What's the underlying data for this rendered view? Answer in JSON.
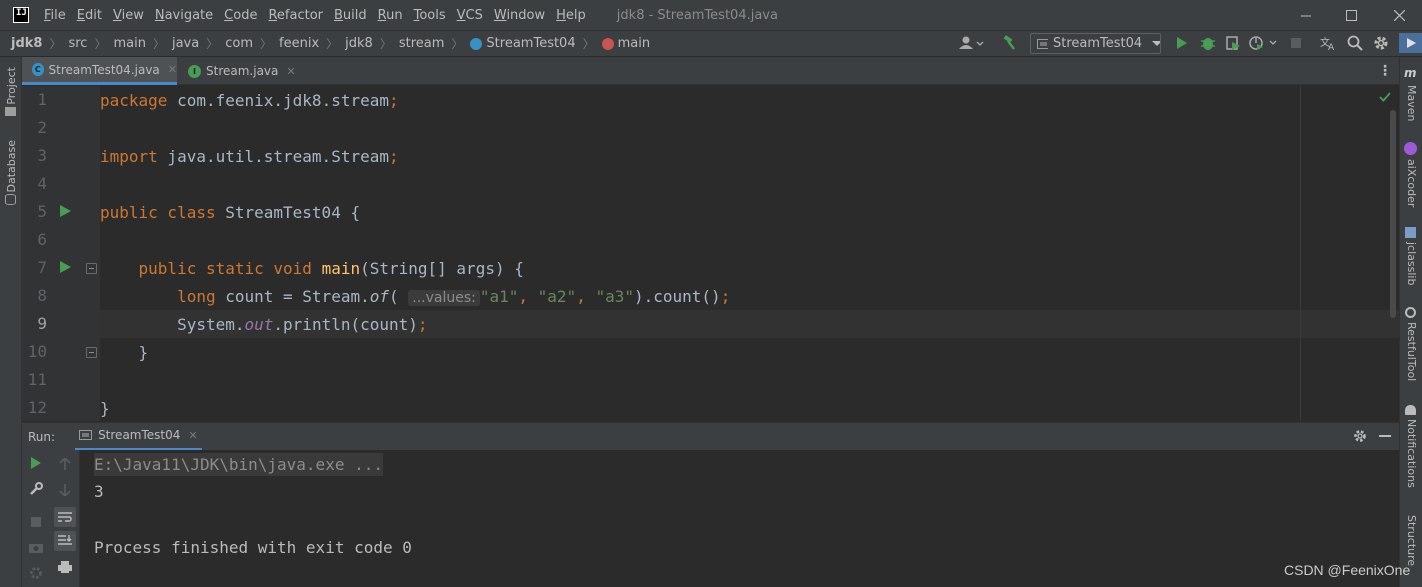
{
  "window": {
    "title": "jdk8 - StreamTest04.java",
    "logo": "IJ"
  },
  "menu": [
    "File",
    "Edit",
    "View",
    "Navigate",
    "Code",
    "Refactor",
    "Build",
    "Run",
    "Tools",
    "VCS",
    "Window",
    "Help"
  ],
  "breadcrumb": {
    "items": [
      "jdk8",
      "src",
      "main",
      "java",
      "com",
      "feenix",
      "jdk8",
      "stream",
      "StreamTest04",
      "main"
    ]
  },
  "toolbar": {
    "run_config": "StreamTest04"
  },
  "tabs": [
    {
      "label": "StreamTest04.java",
      "icon": "C"
    },
    {
      "label": "Stream.java",
      "icon": "I"
    }
  ],
  "editor": {
    "line_numbers": [
      "1",
      "2",
      "3",
      "4",
      "5",
      "6",
      "7",
      "8",
      "9",
      "10",
      "11",
      "12"
    ],
    "current_line": "9",
    "code": {
      "l1_kw": "package",
      "l1_rest": " com.feenix.jdk8.stream",
      "l1_semi": ";",
      "l3_kw": "import",
      "l3_rest": " java.util.stream.Stream",
      "l3_semi": ";",
      "l5_kw": "public class",
      "l5_rest": " StreamTest04 {",
      "l7_indent": "    ",
      "l7_kw": "public static void",
      "l7_space": " ",
      "l7_fn": "main",
      "l7_rest": "(String[] args) {",
      "l8_indent": "        ",
      "l8_kw": "long",
      "l8_a": " count = Stream.",
      "l8_of": "of",
      "l8_paren": "( ",
      "l8_hint": "...values:",
      "l8_s1": "\"a1\"",
      "l8_c1": ", ",
      "l8_s2": "\"a2\"",
      "l8_c2": ", ",
      "l8_s3": "\"a3\"",
      "l8_end": ").count()",
      "l8_semi": ";",
      "l9_indent": "        ",
      "l9_a": "System.",
      "l9_out": "out",
      "l9_b": ".println(count)",
      "l9_semi": ";",
      "l10": "    }",
      "l12": "}"
    }
  },
  "run_panel": {
    "label": "Run:",
    "tab": "StreamTest04",
    "console": [
      "E:\\Java11\\JDK\\bin\\java.exe ...",
      "3",
      "",
      "Process finished with exit code 0"
    ]
  },
  "side_tools": {
    "left": [
      "Project",
      "Database"
    ],
    "right": [
      "Maven",
      "aiXcoder",
      "jclasslib",
      "RestfulTool",
      "Notifications",
      "Structure"
    ]
  },
  "watermark": "CSDN @FeenixOne",
  "colors": {
    "background": "#2b2b2b",
    "keyword": "#cc7832",
    "string": "#6a8759",
    "function": "#ffc66d",
    "static_field": "#9876aa",
    "run_green": "#499c54",
    "accent": "#4a88c7"
  }
}
